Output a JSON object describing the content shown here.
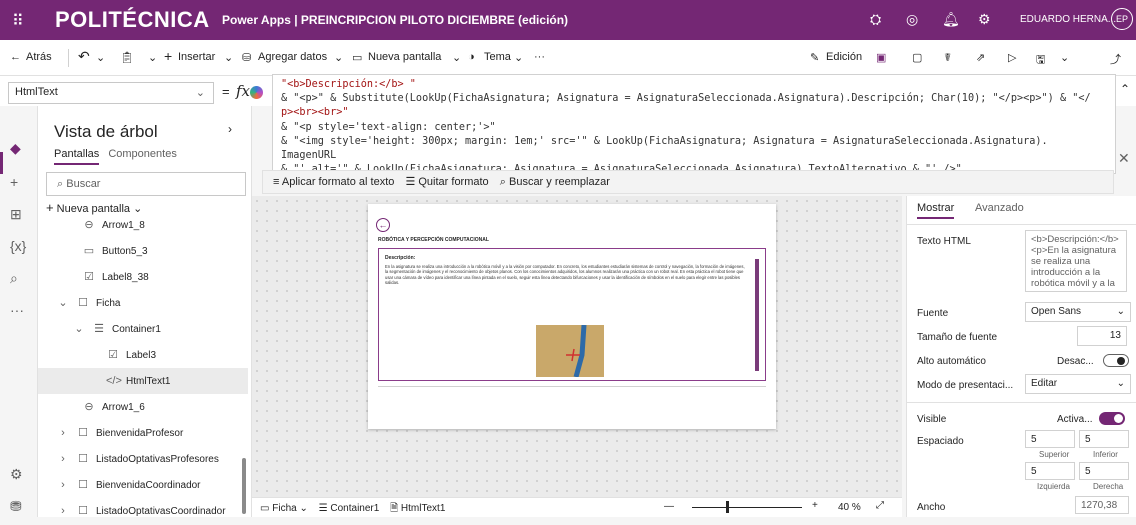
{
  "topbar": {
    "logo": "POLITÉCNICA",
    "title": "Power Apps | PREINCRIPCION PILOTO DICIEMBRE (edición)",
    "user": "EDUARDO HERNA...",
    "avatar": "EP",
    "icons": [
      "waffle-icon",
      "environment-icon",
      "gear-icon",
      "bell-icon",
      "settings-icon"
    ]
  },
  "cmdbar": {
    "back": "Atrás",
    "insert": "Insertar",
    "add_data": "Agregar datos",
    "new_screen": "Nueva pantalla",
    "theme": "Tema",
    "more": "···",
    "edit": "Edición"
  },
  "formula": {
    "property": "HtmlText",
    "eq": "=",
    "fx": "fx",
    "lines": [
      "\"<b>Descripción:</b> \"",
      "& \"<p>\" & Substitute(LookUp(FichaAsignatura; Asignatura = AsignaturaSeleccionada.Asignatura).Descripción; Char(10); \"</p><p>\") & \"</",
      "p><br><br>\"",
      "& \"<p style='text-align: center;'>\"",
      "& \"<img style='height: 300px; margin: 1em;' src='\" & LookUp(FichaAsignatura; Asignatura = AsignaturaSeleccionada.Asignatura).",
      "ImagenURL",
      "& \"' alt='\" & LookUp(FichaAsignatura; Asignatura = AsignaturaSeleccionada.Asignatura).TextoAlternativo & \"' />\""
    ],
    "format_text": "Aplicar formato al texto",
    "remove_format": "Quitar formato",
    "find_replace": "Buscar y reemplazar"
  },
  "tree": {
    "title": "Vista de árbol",
    "tab_screens": "Pantallas",
    "tab_components": "Componentes",
    "search_placeholder": "Buscar",
    "new_screen": "Nueva pantalla",
    "nodes": [
      {
        "label": "Arrow1_8",
        "icon": "arrow-icon",
        "indent": 44
      },
      {
        "label": "Button5_3",
        "icon": "button-icon",
        "indent": 44
      },
      {
        "label": "Label8_38",
        "icon": "label-icon",
        "indent": 44
      },
      {
        "label": "Ficha",
        "icon": "screen-icon",
        "indent": 18
      },
      {
        "label": "Container1",
        "icon": "container-icon",
        "indent": 34
      },
      {
        "label": "Label3",
        "icon": "label-icon",
        "indent": 68
      },
      {
        "label": "HtmlText1",
        "icon": "html-icon",
        "indent": 68
      },
      {
        "label": "Arrow1_6",
        "icon": "arrow-icon",
        "indent": 44
      },
      {
        "label": "BienvenidaProfesor",
        "icon": "screen-icon",
        "indent": 18
      },
      {
        "label": "ListadoOptativasProfesores",
        "icon": "screen-icon",
        "indent": 18
      },
      {
        "label": "BienvenidaCoordinador",
        "icon": "screen-icon",
        "indent": 18
      },
      {
        "label": "ListadoOptativasCoordinador",
        "icon": "screen-icon",
        "indent": 18
      }
    ]
  },
  "preview": {
    "subject": "ROBÓTICA Y PERCEPCIÓN COMPUTACIONAL",
    "desc_label": "Descripción:",
    "desc_text": "En la asignatura se realiza una introducción a la robótica móvil y a la visión por computador. En concreto, los estudiantes estudiarán sistemas de control y navegación, la formación de imágenes, la segmentación de imágenes y el reconocimiento de objetos planos. Con los conocimientos adquiridos, los alumnos realizarán una práctica con un robot real. En esta práctica el robot tiene que usar una cámara de vídeo para identificar una línea pintada en el suelo, seguir esta línea detectando bifurcaciones y usar la identificación de símbolos en el suelo para elegir entre las posibles salidas."
  },
  "footer": {
    "crumb1": "Ficha",
    "crumb2": "Container1",
    "crumb3": "HtmlText1",
    "zoom": "40 %"
  },
  "props": {
    "tab_show": "Mostrar",
    "tab_advanced": "Avanzado",
    "html_label": "Texto HTML",
    "html_value": "<b>Descripción:</b> <p>En la asignatura se realiza una introducción a la robótica móvil y a la",
    "font_label": "Fuente",
    "font_value": "Open Sans",
    "size_label": "Tamaño de fuente",
    "size_value": "13",
    "autoh_label": "Alto automático",
    "autoh_value": "Desac...",
    "mode_label": "Modo de presentaci...",
    "mode_value": "Editar",
    "visible_label": "Visible",
    "visible_value": "Activa...",
    "spacing_label": "Espaciado",
    "pad_top": "5",
    "pad_bottom": "5",
    "pad_left": "5",
    "pad_right": "5",
    "top_label": "Superior",
    "bottom_label": "Inferior",
    "left_label": "Izquierda",
    "right_label": "Derecha",
    "width_label": "Ancho",
    "width_value": "1270,38"
  }
}
